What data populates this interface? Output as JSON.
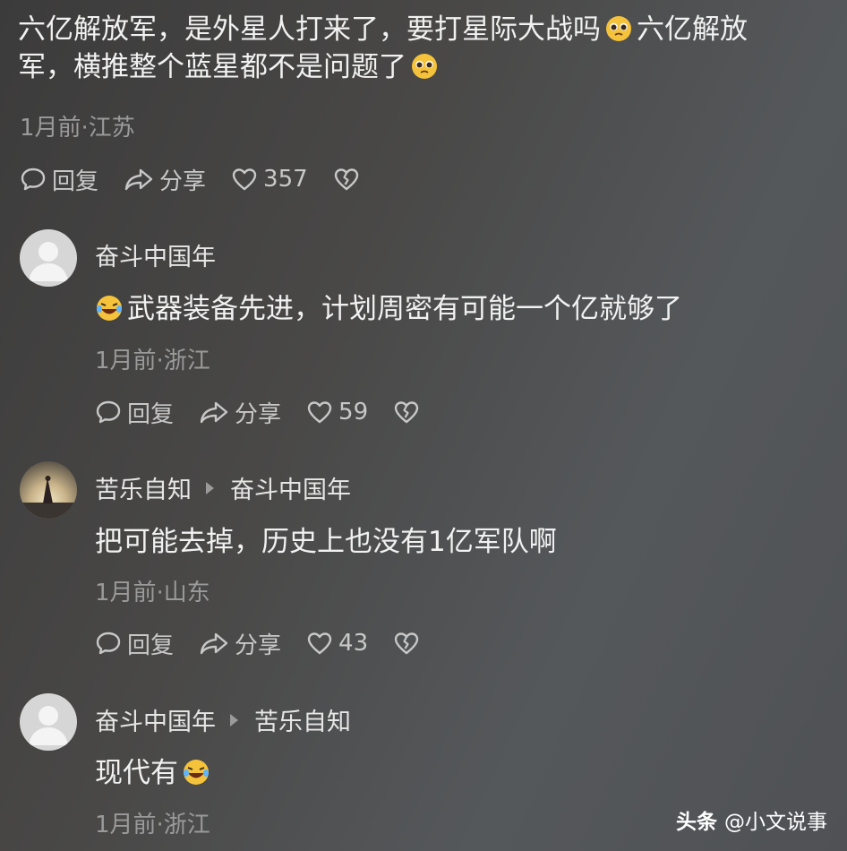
{
  "top_comment": {
    "text_part1": "六亿解放军，是外星人打来了，要打星际大战吗",
    "text_part2": "六亿解放",
    "text_line2": "军，横推整个蓝星都不是问题了",
    "emoji1": "pleading-face-emoji",
    "emoji2": "pleading-face-emoji",
    "meta": "1月前·江苏",
    "reply_label": "回复",
    "share_label": "分享",
    "like_count": "357"
  },
  "comments": [
    {
      "author": "奋斗中国年",
      "reply_to": "",
      "emoji": "rolling-laughing-emoji",
      "text": "武器装备先进，计划周密有可能一个亿就够了",
      "meta": "1月前·浙江",
      "reply_label": "回复",
      "share_label": "分享",
      "like_count": "59",
      "avatar": "default-avatar"
    },
    {
      "author": "苦乐自知",
      "reply_to": "奋斗中国年",
      "text": "把可能去掉，历史上也没有1亿军队啊",
      "meta": "1月前·山东",
      "reply_label": "回复",
      "share_label": "分享",
      "like_count": "43",
      "avatar": "photo-avatar"
    },
    {
      "author": "奋斗中国年",
      "reply_to": "苦乐自知",
      "text": "现代有",
      "emoji": "rolling-laughing-emoji",
      "meta": "1月前·浙江",
      "avatar": "default-avatar"
    }
  ],
  "watermark": {
    "brand": "头条",
    "account": "@小文说事"
  },
  "colors": {
    "text_primary": "#f1f1f1",
    "text_meta": "#9a9a9a",
    "emoji_yellow": "#f5c33b"
  }
}
